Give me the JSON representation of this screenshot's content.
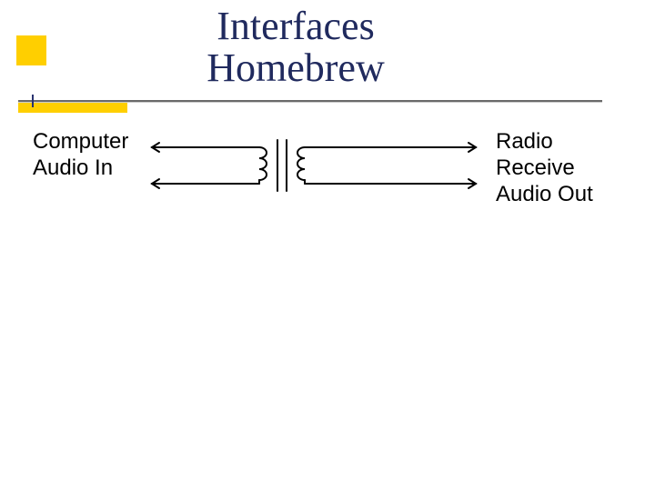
{
  "title": {
    "line1": "Interfaces",
    "line2": "Homebrew"
  },
  "labels": {
    "left_line1": "Computer",
    "left_line2": "Audio  In",
    "right_line1": "Radio",
    "right_line2": "Receive",
    "right_line3": "Audio Out"
  },
  "diagram": {
    "component": "isolation-transformer",
    "left_side": "Computer Audio In",
    "right_side": "Radio Receive Audio Out"
  },
  "colors": {
    "accent": "#ffcf00",
    "title": "#202a5e",
    "line": "#6a6a6a"
  }
}
